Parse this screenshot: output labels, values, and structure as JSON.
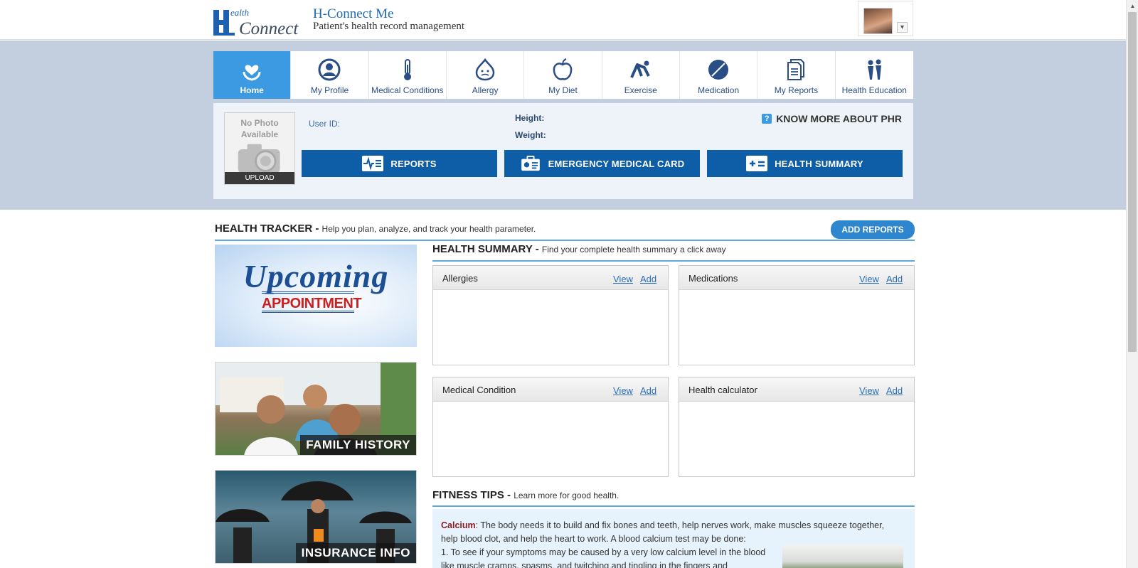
{
  "header": {
    "logo_text_top": "ealth",
    "logo_text_main": "Connect",
    "title": "H-Connect Me",
    "subtitle": "Patient's health record management"
  },
  "nav": {
    "items": [
      {
        "label": "Home",
        "icon": "heart-hands-icon",
        "active": true
      },
      {
        "label": "My Profile",
        "icon": "user-circle-icon",
        "active": false
      },
      {
        "label": "Medical Conditions",
        "icon": "thermometer-icon",
        "active": false
      },
      {
        "label": "Allergy",
        "icon": "allergy-face-icon",
        "active": false
      },
      {
        "label": "My Diet",
        "icon": "apple-icon",
        "active": false
      },
      {
        "label": "Exercise",
        "icon": "exercise-icon",
        "active": false
      },
      {
        "label": "Medication",
        "icon": "pill-icon",
        "active": false
      },
      {
        "label": "My Reports",
        "icon": "document-icon",
        "active": false
      },
      {
        "label": "Health Education",
        "icon": "people-icon",
        "active": false
      }
    ]
  },
  "profile": {
    "photo_text": "No Photo Available",
    "upload_label": "UPLOAD",
    "user_id_label": "User ID:",
    "height_label": "Height:",
    "weight_label": "Weight:",
    "know_more": "KNOW MORE ABOUT PHR",
    "know_more_icon": "?",
    "buttons": {
      "reports": "REPORTS",
      "emergency": "EMERGENCY MEDICAL CARD",
      "summary": "HEALTH SUMMARY"
    }
  },
  "tracker": {
    "title": "HEALTH TRACKER -",
    "desc": "Help you plan, analyze, and track your health parameter.",
    "add_reports": "ADD REPORTS",
    "promos": {
      "upcoming_script": "Upcoming",
      "upcoming_box": "APPOINTMENT",
      "family": "FAMILY HISTORY",
      "insurance": "INSURANCE INFO"
    }
  },
  "summary": {
    "title": "HEALTH SUMMARY -",
    "desc": "Find your complete health summary a click away",
    "cards": [
      {
        "title": "Allergies",
        "view": "View",
        "add": "Add"
      },
      {
        "title": "Medications",
        "view": "View",
        "add": "Add"
      },
      {
        "title": "Medical Condition",
        "view": "View",
        "add": "Add"
      },
      {
        "title": "Health calculator",
        "view": "View",
        "add": "Add"
      }
    ]
  },
  "fitness": {
    "title": "FITNESS TIPS -",
    "desc": "Learn more for good health.",
    "keyword": "Calcium",
    "text": ": The body needs it to build and fix bones and teeth, help nerves work, make muscles squeeze together, help blood clot, and help the heart to work. A blood calcium test may be done:",
    "point": "1. To see if your symptoms may be caused by a very low calcium level in the blood like muscle cramps, spasms, and twitching and tingling in the fingers and"
  },
  "colors": {
    "accent": "#3b9ae1",
    "band": "#c3cfdf",
    "button": "#0d5ea6"
  }
}
